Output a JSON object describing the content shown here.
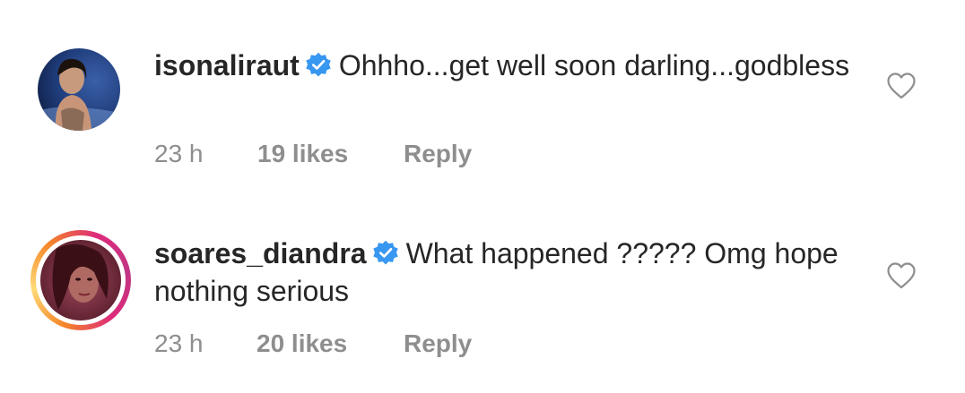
{
  "comments": [
    {
      "username": "isonaliraut",
      "verified": true,
      "text": "Ohhho...get well soon darling...godbless",
      "time": "23 h",
      "likes": "19 likes",
      "reply_label": "Reply",
      "has_story_ring": false,
      "avatar_icon": "profile-photo"
    },
    {
      "username": "soares_diandra",
      "verified": true,
      "text": "What happened ????? Omg hope nothing serious",
      "time": "23 h",
      "likes": "20 likes",
      "reply_label": "Reply",
      "has_story_ring": true,
      "avatar_icon": "profile-photo"
    }
  ],
  "icons": {
    "verified": "verified-badge-icon",
    "like": "heart-outline-icon"
  },
  "colors": {
    "verified_blue": "#3897f0",
    "meta_gray": "#8e8e8e",
    "text": "#262626",
    "story_ring": [
      "#f58529",
      "#dd2a7b",
      "#c13584"
    ]
  }
}
